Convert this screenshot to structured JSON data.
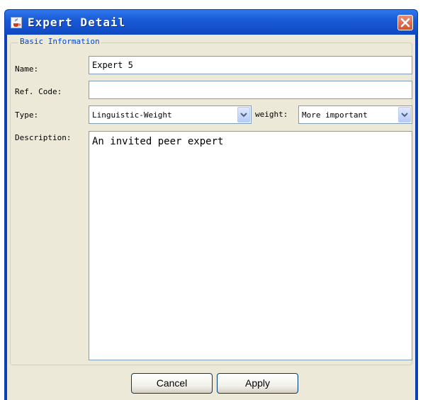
{
  "window": {
    "title": "Expert Detail",
    "icon": "java-cup-icon",
    "close_icon": "close-icon"
  },
  "group": {
    "legend": "Basic Information"
  },
  "form": {
    "name_label": "Name:",
    "name_value": "Expert 5",
    "refcode_label": "Ref. Code:",
    "refcode_value": "",
    "type_label": "Type:",
    "type_selected": "Linguistic-Weight",
    "weight_label": "weight:",
    "weight_selected": "More important",
    "description_label": "Description:",
    "description_value": "An invited peer expert"
  },
  "buttons": {
    "cancel_label": "Cancel",
    "apply_label": "Apply"
  },
  "colors": {
    "title_bar": "#1a5ad6",
    "window_bg": "#ece9d8",
    "legend_text": "#0046d5",
    "close_button": "#d4512f",
    "field_border": "#7f9db9"
  }
}
